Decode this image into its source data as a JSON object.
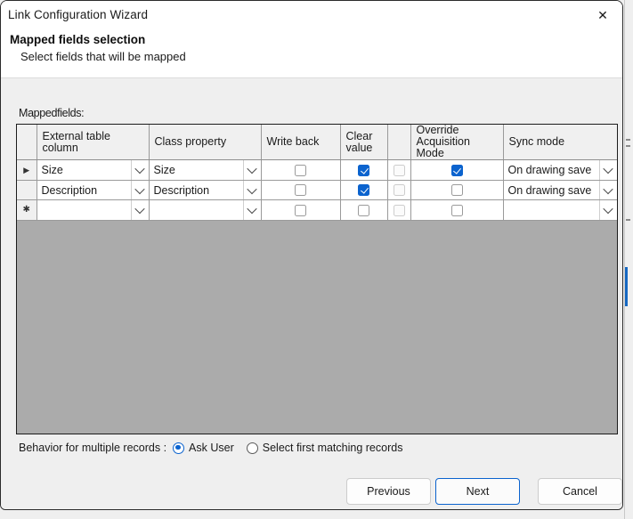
{
  "window": {
    "title": "Link Configuration Wizard",
    "close_icon": "close-icon",
    "headline": "Mapped fields selection",
    "subline": "Select fields that will be mapped"
  },
  "grid": {
    "label": "Mappedfields:",
    "columns": [
      {
        "key": "rowhdr",
        "label": ""
      },
      {
        "key": "external_table_column",
        "label": "External table column"
      },
      {
        "key": "class_property",
        "label": "Class property"
      },
      {
        "key": "write_back",
        "label": "Write back"
      },
      {
        "key": "clear_value",
        "label": "Clear\nvalue"
      },
      {
        "key": "unnamed",
        "label": ""
      },
      {
        "key": "override_acquisition_mode",
        "label": "Override\nAcquisition Mode"
      },
      {
        "key": "sync_mode",
        "label": "Sync mode"
      }
    ],
    "column_labels": {
      "external_table_column": "External table column",
      "class_property": "Class property",
      "write_back": "Write back",
      "clear_value_line1": "Clear",
      "clear_value_line2": "value",
      "unnamed": "",
      "override_line1": "Override",
      "override_line2": "Acquisition Mode",
      "sync_mode": "Sync mode"
    },
    "rows": [
      {
        "marker": "▶",
        "external_table_column": "Size",
        "class_property": "Size",
        "write_back": false,
        "clear_value": true,
        "unnamed": false,
        "override_acquisition_mode": true,
        "sync_mode": "On drawing save"
      },
      {
        "marker": "",
        "external_table_column": "Description",
        "class_property": "Description",
        "write_back": false,
        "clear_value": true,
        "unnamed": false,
        "override_acquisition_mode": false,
        "sync_mode": "On drawing save"
      },
      {
        "marker": "✱",
        "external_table_column": "",
        "class_property": "",
        "write_back": false,
        "clear_value": false,
        "unnamed": false,
        "override_acquisition_mode": false,
        "sync_mode": ""
      }
    ]
  },
  "behavior": {
    "label": "Behavior for multiple records :",
    "options": [
      {
        "label": "Ask User",
        "selected": true
      },
      {
        "label": "Select first matching records",
        "selected": false
      }
    ]
  },
  "footer": {
    "previous": "Previous",
    "next": "Next",
    "cancel": "Cancel"
  },
  "colors": {
    "accent": "#0b63ce",
    "dialog_bg": "#efefef",
    "grid_empty": "#ababab",
    "header_bg": "#f0f0f0",
    "border": "#1c1c1c"
  }
}
